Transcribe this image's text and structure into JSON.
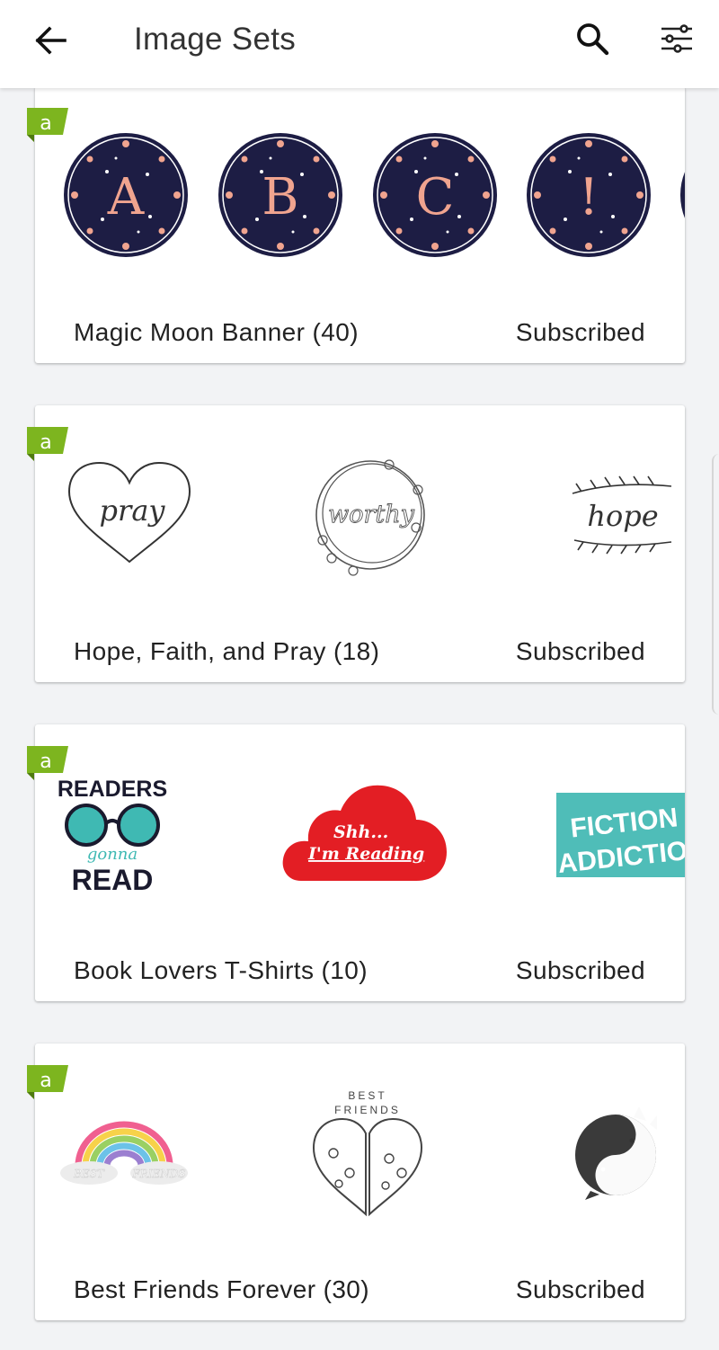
{
  "header": {
    "title": "Image Sets",
    "back_icon": "arrow-left-icon",
    "search_icon": "search-icon",
    "filter_icon": "sliders-icon"
  },
  "sets": [
    {
      "name": "Magic Moon Banner (40)",
      "status": "Subscribed",
      "thumbnails": [
        "A",
        "B",
        "C",
        "!"
      ]
    },
    {
      "name": "Hope, Faith, and Pray (18)",
      "status": "Subscribed",
      "thumbnails": [
        "pray",
        "worthy",
        "hope"
      ]
    },
    {
      "name": "Book Lovers T-Shirts (10)",
      "status": "Subscribed",
      "thumbnails": [
        "READERS",
        "gonna",
        "READ",
        "Shh...",
        "I'm Reading",
        "FICTION",
        "ADDICTION"
      ]
    },
    {
      "name": "Best Friends Forever (30)",
      "status": "Subscribed",
      "thumbnails": [
        "BEST",
        "FRIENDS",
        "BEST FRIENDS"
      ]
    }
  ],
  "colors": {
    "ribbon": "#7db51f",
    "moon_navy": "#1d1d44",
    "moon_peach": "#f0a48f",
    "shh_red": "#e31e24",
    "fiction_teal": "#4fbdb8",
    "readers_teal": "#3fb9b3"
  }
}
